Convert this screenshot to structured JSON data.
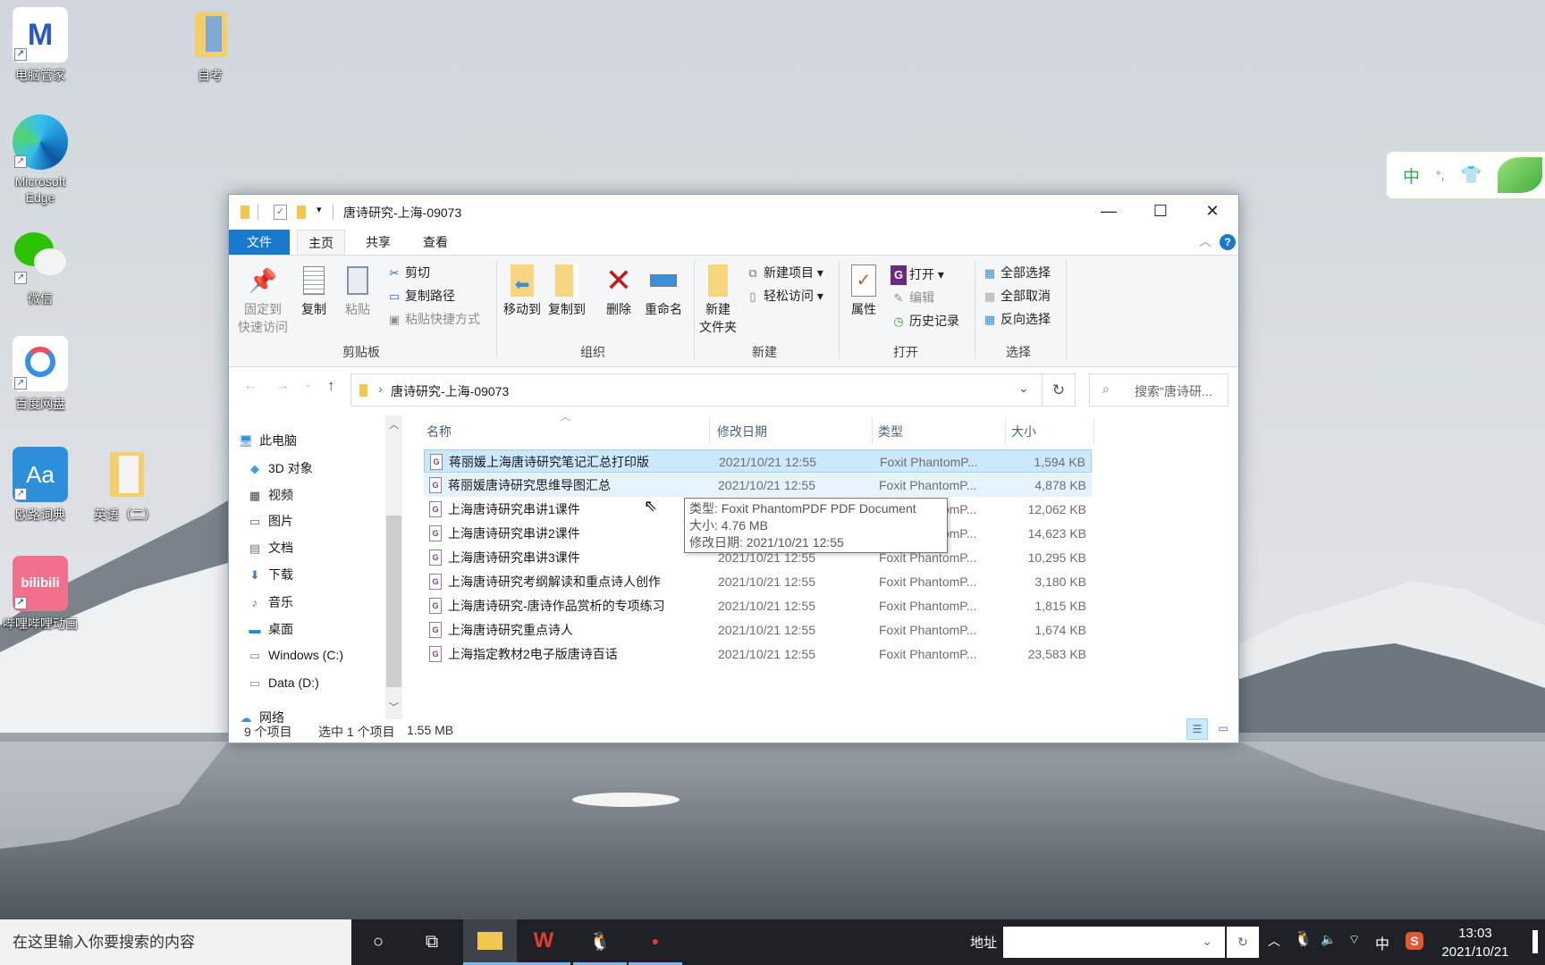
{
  "desktop": {
    "icons": [
      {
        "label": "电脑管家",
        "icon": "pc-manager-icon"
      },
      {
        "label": "Microsoft Edge",
        "icon": "edge-icon"
      },
      {
        "label": "微信",
        "icon": "wechat-icon"
      },
      {
        "label": "百度网盘",
        "icon": "baidu-netdisk-icon"
      },
      {
        "label": "欧路词典",
        "icon": "eudic-icon"
      },
      {
        "label": "哔哩哔哩动画",
        "icon": "bilibili-icon"
      },
      {
        "label": "自考",
        "icon": "folder-icon"
      },
      {
        "label": "英语（二）",
        "icon": "folder-icon"
      }
    ]
  },
  "ime_bar": {
    "mode": "中",
    "punct": "°,",
    "skin": "shirt-icon"
  },
  "window": {
    "title": "唐诗研究-上海-09073",
    "tabs": [
      "文件",
      "主页",
      "共享",
      "查看"
    ],
    "ribbon": {
      "clipboard": {
        "group": "剪贴板",
        "pin": "固定到\n快速访问",
        "pin_l1": "固定到",
        "pin_l2": "快速访问",
        "copy": "复制",
        "paste": "粘贴",
        "cut": "剪切",
        "copy_path": "复制路径",
        "paste_shortcut": "粘贴快捷方式"
      },
      "organize": {
        "group": "组织",
        "move_to": "移动到",
        "copy_to": "复制到",
        "delete": "删除",
        "rename": "重命名"
      },
      "new": {
        "group": "新建",
        "new_folder_l1": "新建",
        "new_folder_l2": "文件夹",
        "new_item": "新建项目",
        "easy_access": "轻松访问"
      },
      "open": {
        "group": "打开",
        "properties": "属性",
        "open": "打开",
        "edit": "编辑",
        "history": "历史记录"
      },
      "select": {
        "group": "选择",
        "select_all": "全部选择",
        "select_none": "全部取消",
        "invert": "反向选择"
      }
    },
    "address": {
      "path": "唐诗研究-上海-09073",
      "search_placeholder": "搜索\"唐诗研..."
    },
    "nav": [
      {
        "label": "此电脑",
        "icon": "computer-icon"
      },
      {
        "label": "3D 对象",
        "icon": "3d-objects-icon"
      },
      {
        "label": "视频",
        "icon": "video-icon"
      },
      {
        "label": "图片",
        "icon": "pictures-icon"
      },
      {
        "label": "文档",
        "icon": "documents-icon"
      },
      {
        "label": "下载",
        "icon": "download-icon"
      },
      {
        "label": "音乐",
        "icon": "music-icon"
      },
      {
        "label": "桌面",
        "icon": "desktop-icon"
      },
      {
        "label": "Windows (C:)",
        "icon": "drive-icon"
      },
      {
        "label": "Data (D:)",
        "icon": "drive-icon"
      },
      {
        "label": "网络",
        "icon": "network-icon"
      }
    ],
    "columns": {
      "name": "名称",
      "date": "修改日期",
      "type": "类型",
      "size": "大小"
    },
    "files": [
      {
        "name": "蒋丽媛上海唐诗研究笔记汇总打印版",
        "date": "2021/10/21 12:55",
        "type": "Foxit PhantomP...",
        "size": "1,594 KB",
        "state": "selected"
      },
      {
        "name": "蒋丽媛唐诗研究思维导图汇总",
        "date": "2021/10/21 12:55",
        "type": "Foxit PhantomP...",
        "size": "4,878 KB",
        "state": "hover"
      },
      {
        "name": "上海唐诗研究串讲1课件",
        "date": "2021/10/21 12:55",
        "type": "Foxit PhantomP...",
        "size": "12,062 KB"
      },
      {
        "name": "上海唐诗研究串讲2课件",
        "date": "2021/10/21 12:55",
        "type": "Foxit PhantomP...",
        "size": "14,623 KB"
      },
      {
        "name": "上海唐诗研究串讲3课件",
        "date": "2021/10/21 12:55",
        "type": "Foxit PhantomP...",
        "size": "10,295 KB"
      },
      {
        "name": "上海唐诗研究考纲解读和重点诗人创作",
        "date": "2021/10/21 12:55",
        "type": "Foxit PhantomP...",
        "size": "3,180 KB"
      },
      {
        "name": "上海唐诗研究-唐诗作品赏析的专项练习",
        "date": "2021/10/21 12:55",
        "type": "Foxit PhantomP...",
        "size": "1,815 KB"
      },
      {
        "name": "上海唐诗研究重点诗人",
        "date": "2021/10/21 12:55",
        "type": "Foxit PhantomP...",
        "size": "1,674 KB"
      },
      {
        "name": "上海指定教材2电子版唐诗百话",
        "date": "2021/10/21 12:55",
        "type": "Foxit PhantomP...",
        "size": "23,583 KB"
      }
    ],
    "tooltip": {
      "type": "类型: Foxit PhantomPDF PDF Document",
      "size": "大小: 4.76 MB",
      "date": "修改日期: 2021/10/21 12:55"
    },
    "status": {
      "count": "9 个项目",
      "selected": "选中 1 个项目",
      "selected_size": "1.55 MB"
    }
  },
  "taskbar": {
    "search_placeholder": "在这里输入你要搜索的内容",
    "address_label": "地址",
    "tray": {
      "ime": "中",
      "time": "13:03",
      "date": "2021/10/21"
    }
  },
  "colors": {
    "accent": "#1979ca",
    "selection": "#cce8ff",
    "taskbar": "#1e2226"
  }
}
